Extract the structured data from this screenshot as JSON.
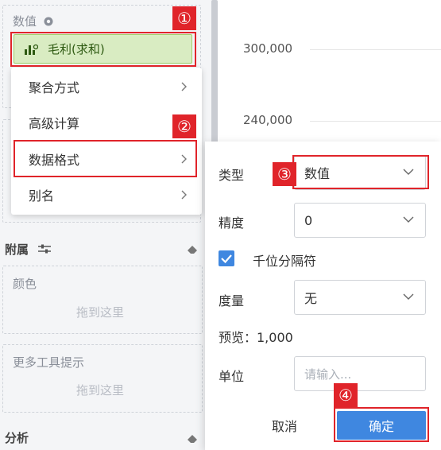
{
  "left_panel": {
    "values_section": {
      "label": "数值"
    },
    "measure_pill": {
      "label": "毛利(求和)"
    },
    "menu_items": [
      {
        "label": "聚合方式"
      },
      {
        "label": "高级计算"
      },
      {
        "label": "数据格式"
      },
      {
        "label": "别名"
      }
    ],
    "attach_section": {
      "label": "附属"
    },
    "color_box": {
      "label": "颜色",
      "hint": "拖到这里"
    },
    "tooltip_box": {
      "label": "更多工具提示",
      "hint": "拖到这里"
    },
    "analysis_section": {
      "label": "分析"
    }
  },
  "chart_axis": {
    "ticks": [
      "300,000",
      "240,000"
    ]
  },
  "format_dialog": {
    "type": {
      "label": "类型",
      "value": "数值"
    },
    "precision": {
      "label": "精度",
      "value": "0"
    },
    "thousands": {
      "label": "千位分隔符",
      "checked": true
    },
    "measure": {
      "label": "度量",
      "value": "无"
    },
    "preview": {
      "text": "预览：1,000"
    },
    "unit": {
      "label": "单位",
      "placeholder": "请输入..."
    },
    "cancel_label": "取消",
    "confirm_label": "确定"
  },
  "annotations": [
    "①",
    "②",
    "③",
    "④"
  ],
  "colors": {
    "accent": "#3f87e0",
    "annotation_red": "#e0242a",
    "pill_fill": "#d9ecc2"
  },
  "icons": [
    "gear-icon",
    "bar-chart-icon",
    "chevron-right-icon",
    "chevron-down-icon",
    "sliders-icon",
    "eraser-icon",
    "checkmark-icon"
  ]
}
